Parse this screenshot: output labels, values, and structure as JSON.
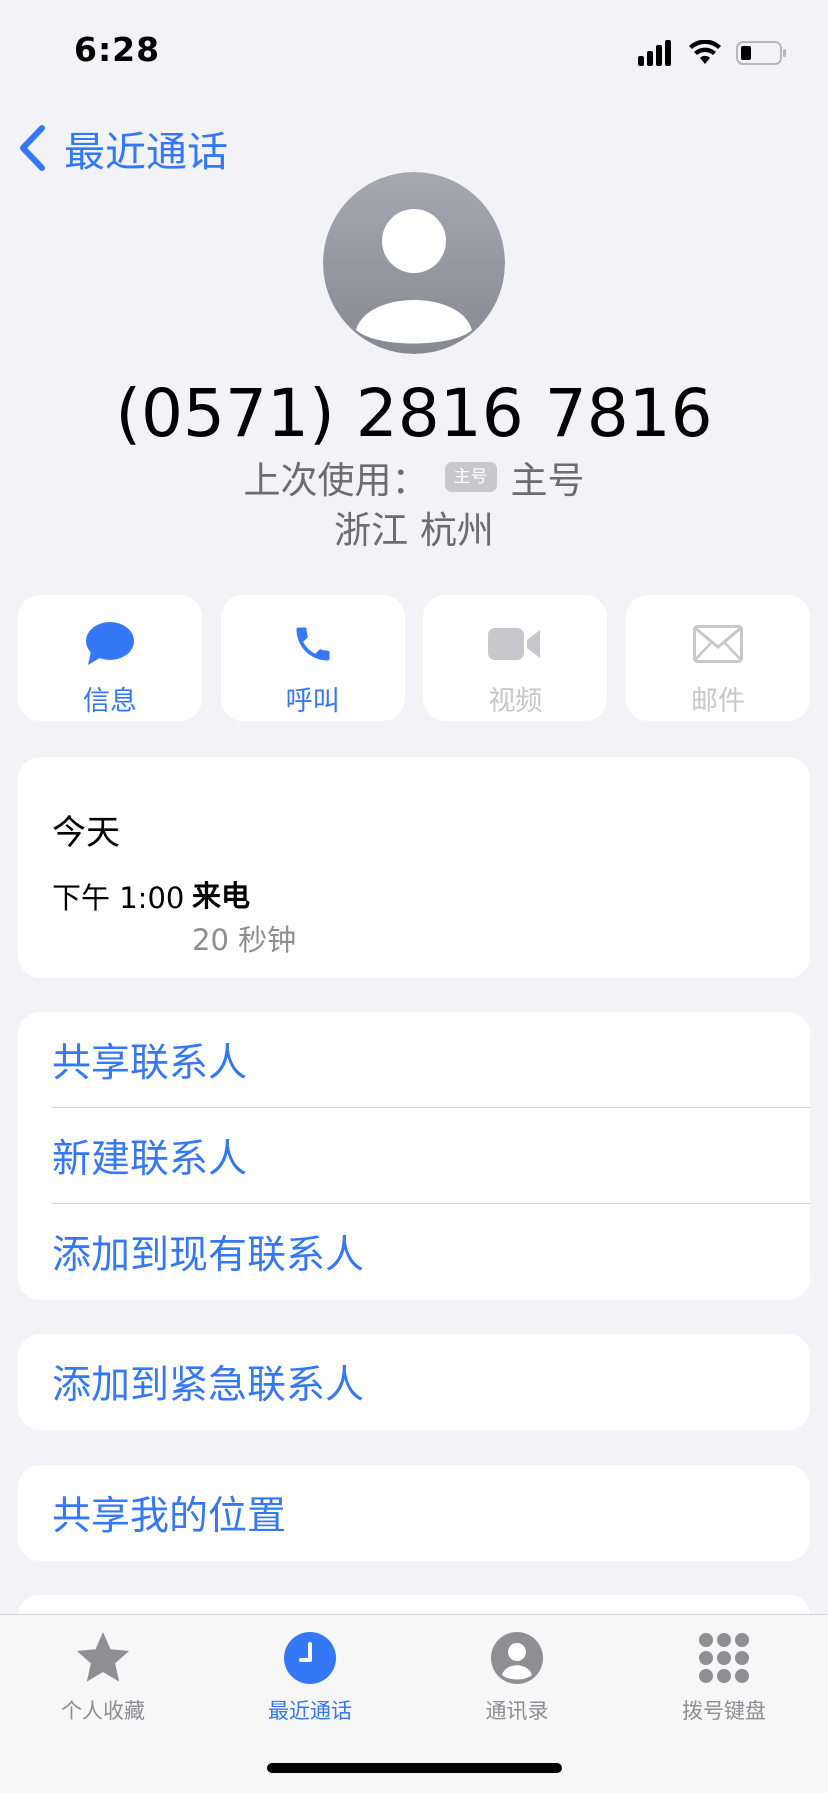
{
  "status_bar": {
    "time": "6:28"
  },
  "nav": {
    "back_label": "最近通话"
  },
  "contact": {
    "phone_number": "(0571) 2816 7816",
    "last_used_label": "上次使用：",
    "sim_badge": "主号",
    "sim_name": "主号",
    "location": "浙江 杭州"
  },
  "actions": [
    {
      "label": "信息",
      "icon": "message-icon",
      "enabled": true
    },
    {
      "label": "呼叫",
      "icon": "phone-icon",
      "enabled": true
    },
    {
      "label": "视频",
      "icon": "video-icon",
      "enabled": false
    },
    {
      "label": "邮件",
      "icon": "mail-icon",
      "enabled": false
    }
  ],
  "call_history": {
    "day": "今天",
    "time": "下午 1:00",
    "type": "来电",
    "duration": "20 秒钟"
  },
  "contact_options": [
    "共享联系人",
    "新建联系人",
    "添加到现有联系人"
  ],
  "emergency_option": "添加到紧急联系人",
  "location_option": "共享我的位置",
  "tab_bar": {
    "tabs": [
      {
        "label": "个人收藏",
        "icon": "star-icon",
        "active": false
      },
      {
        "label": "最近通话",
        "icon": "clock-icon",
        "active": true
      },
      {
        "label": "通讯录",
        "icon": "contacts-icon",
        "active": false
      },
      {
        "label": "拨号键盘",
        "icon": "keypad-icon",
        "active": false
      }
    ]
  },
  "colors": {
    "accent": "#3478f6",
    "secondary_text": "#8e8e93",
    "background": "#f2f2f7"
  }
}
